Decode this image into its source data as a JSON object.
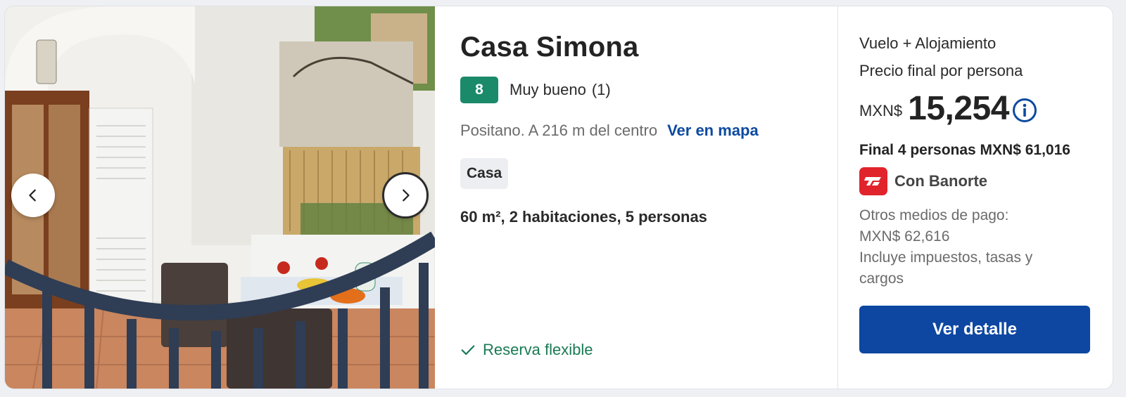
{
  "listing": {
    "title": "Casa Simona",
    "rating": {
      "score": "8",
      "label": "Muy bueno",
      "count": "(1)"
    },
    "location": {
      "text": "Positano. A 216 m del centro",
      "map_link": "Ver en mapa"
    },
    "property_type": "Casa",
    "specs": "60 m², 2 habitaciones, 5 personas",
    "flexible": "Reserva flexible",
    "photo": {
      "description_icon": "photo",
      "prev_icon": "chevron-left-icon",
      "next_icon": "chevron-right-icon"
    }
  },
  "pricing": {
    "package_label": "Vuelo + Alojamiento",
    "per_person_label": "Precio final por persona",
    "currency": "MXN$",
    "amount": "15,254",
    "total_line": "Final 4 personas MXN$ 61,016",
    "bank": "Con Banorte",
    "other_payment": [
      "Otros medios de pago:",
      "MXN$ 62,616",
      "Incluye impuestos, tasas y",
      "cargos"
    ],
    "cta": "Ver detalle"
  },
  "colors": {
    "score_badge": "#1a8a6a",
    "link": "#0d4aa0",
    "flexible": "#1a7a55",
    "cta": "#0d47a1",
    "bank_logo": "#e1242c"
  }
}
